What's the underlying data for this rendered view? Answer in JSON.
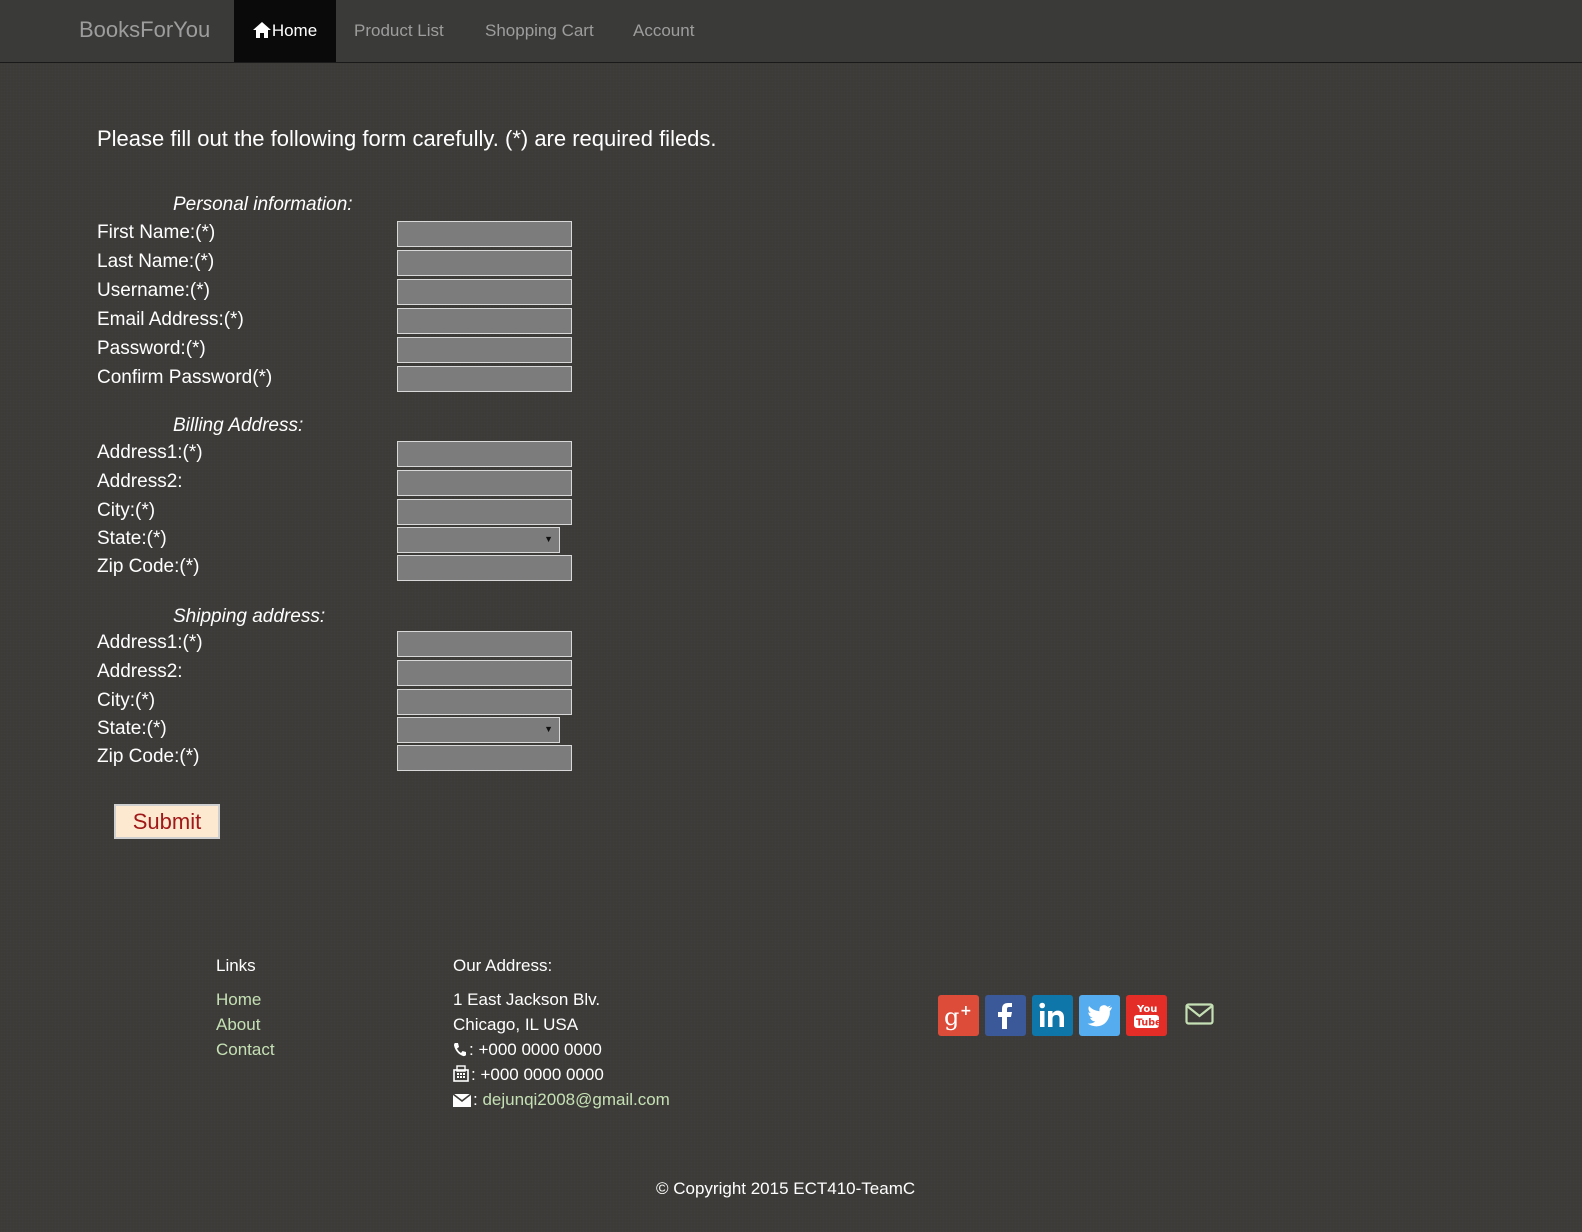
{
  "nav": {
    "brand": "BooksForYou",
    "items": [
      {
        "label": "Home",
        "active": true
      },
      {
        "label": "Product List"
      },
      {
        "label": "Shopping Cart"
      },
      {
        "label": "Account"
      }
    ]
  },
  "form": {
    "intro": "Please fill out the following form carefully. (*) are required fileds.",
    "personal": {
      "heading": "Personal information:",
      "fields": [
        "First Name:(*)",
        "Last Name:(*)",
        "Username:(*)",
        "Email Address:(*)",
        "Password:(*)",
        "Confirm Password(*)"
      ]
    },
    "billing": {
      "heading": "Billing Address:",
      "fields": [
        "Address1:(*)",
        "Address2:",
        "City:(*)",
        "State:(*)",
        "Zip Code:(*)"
      ]
    },
    "shipping": {
      "heading": "Shipping address:",
      "fields": [
        "Address1:(*)",
        "Address2:",
        "City:(*)",
        "State:(*)",
        "Zip Code:(*)"
      ]
    },
    "submit_label": "Submit"
  },
  "footer": {
    "links_heading": "Links",
    "links": [
      "Home",
      "About",
      "Contact"
    ],
    "address_heading": "Our Address:",
    "address_line1": "1 East Jackson Blv.",
    "address_line2": "Chicago, IL USA",
    "phone": ": +000 0000 0000",
    "fax": ": +000 0000 0000",
    "email_sep": ":",
    "email": "dejunqi2008@gmail.com",
    "social": [
      "google-plus-icon",
      "facebook-icon",
      "linkedin-icon",
      "twitter-icon",
      "youtube-icon",
      "envelope-icon"
    ],
    "social_colors": {
      "google": "#dd4b39",
      "facebook": "#3b5998",
      "linkedin": "#0e76a8",
      "twitter": "#55acee",
      "youtube": "#e52d27"
    },
    "copyright": "© Copyright 2015 ECT410-TeamC"
  }
}
